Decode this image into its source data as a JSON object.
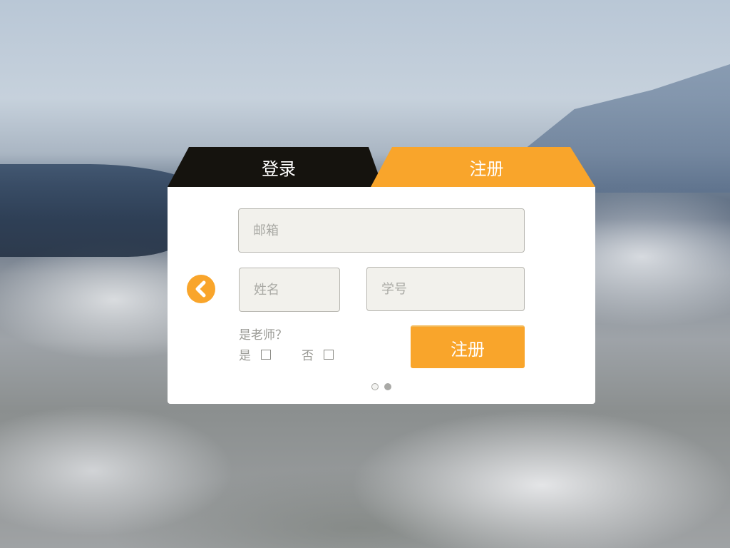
{
  "tabs": {
    "login_label": "登录",
    "register_label": "注册"
  },
  "form": {
    "email_placeholder": "邮箱",
    "name_placeholder": "姓名",
    "student_id_placeholder": "学号",
    "teacher_question": "是老师？",
    "option_yes": "是",
    "option_no": "否",
    "submit_label": "注册"
  },
  "pagination": {
    "total": 2,
    "active_index": 2
  },
  "colors": {
    "accent": "#f9a52b",
    "login_tab": "#15130e",
    "input_bg": "#f2f1ec"
  },
  "icons": {
    "back": "chevron-left-icon"
  }
}
